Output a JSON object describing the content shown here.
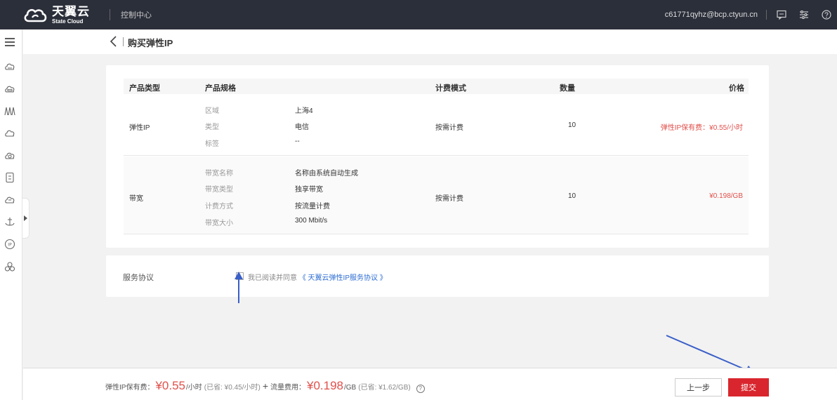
{
  "header": {
    "logo_cn": "天翼云",
    "logo_en": "State Cloud",
    "console": "控制中心",
    "user_email": "c61771qyhz@bcp.ctyun.cn"
  },
  "page": {
    "title": "购买弹性IP"
  },
  "table": {
    "headers": [
      "产品类型",
      "产品规格",
      "计费模式",
      "数量",
      "价格"
    ],
    "rows": [
      {
        "type": "弹性IP",
        "specs": [
          {
            "key": "区域",
            "value": "上海4"
          },
          {
            "key": "类型",
            "value": "电信"
          },
          {
            "key": "标签",
            "value": "--"
          }
        ],
        "billing": "按需计费",
        "quantity": "10",
        "price": "弹性IP保有费：¥0.55/小时"
      },
      {
        "type": "带宽",
        "specs": [
          {
            "key": "带宽名称",
            "value": "名称由系统自动生成"
          },
          {
            "key": "带宽类型",
            "value": "独享带宽"
          },
          {
            "key": "计费方式",
            "value": "按流量计费"
          },
          {
            "key": "带宽大小",
            "value": "300 Mbit/s"
          }
        ],
        "billing": "按需计费",
        "quantity": "10",
        "price": "¥0.198/GB"
      }
    ]
  },
  "agreement": {
    "label": "服务协议",
    "checked": false,
    "text": "我已阅读并同意",
    "link": "《 天翼云弹性IP服务协议 》"
  },
  "footer": {
    "ip_fee_label": "弹性IP保有费：",
    "ip_fee_value": "¥0.55",
    "ip_fee_unit": "/小时",
    "ip_fee_saved": "(已省: ¥0.45/小时)",
    "plus": "+",
    "traffic_fee_label": "流量费用：",
    "traffic_fee_value": "¥0.198",
    "traffic_fee_unit": "/GB",
    "traffic_fee_saved": "(已省: ¥1.62/GB)",
    "help": "?",
    "prev_button": "上一步",
    "submit_button": "提交"
  },
  "colors": {
    "topbar": "#2b2f3a",
    "price_red": "#e0504b",
    "submit_red": "#d9262e",
    "link_blue": "#2d6dd2",
    "annotation_blue": "#3a5fc8"
  },
  "icons": {
    "sidebar": [
      "menu-icon",
      "cloud-server-icon",
      "cloud-disk-icon",
      "network-icon",
      "cloud-icon",
      "cloud-upload-icon",
      "storage-icon",
      "cloud-service-icon",
      "anchor-icon",
      "ip-icon",
      "cluster-icon"
    ],
    "topbar": [
      "message-icon",
      "settings-icon",
      "help-icon"
    ]
  }
}
